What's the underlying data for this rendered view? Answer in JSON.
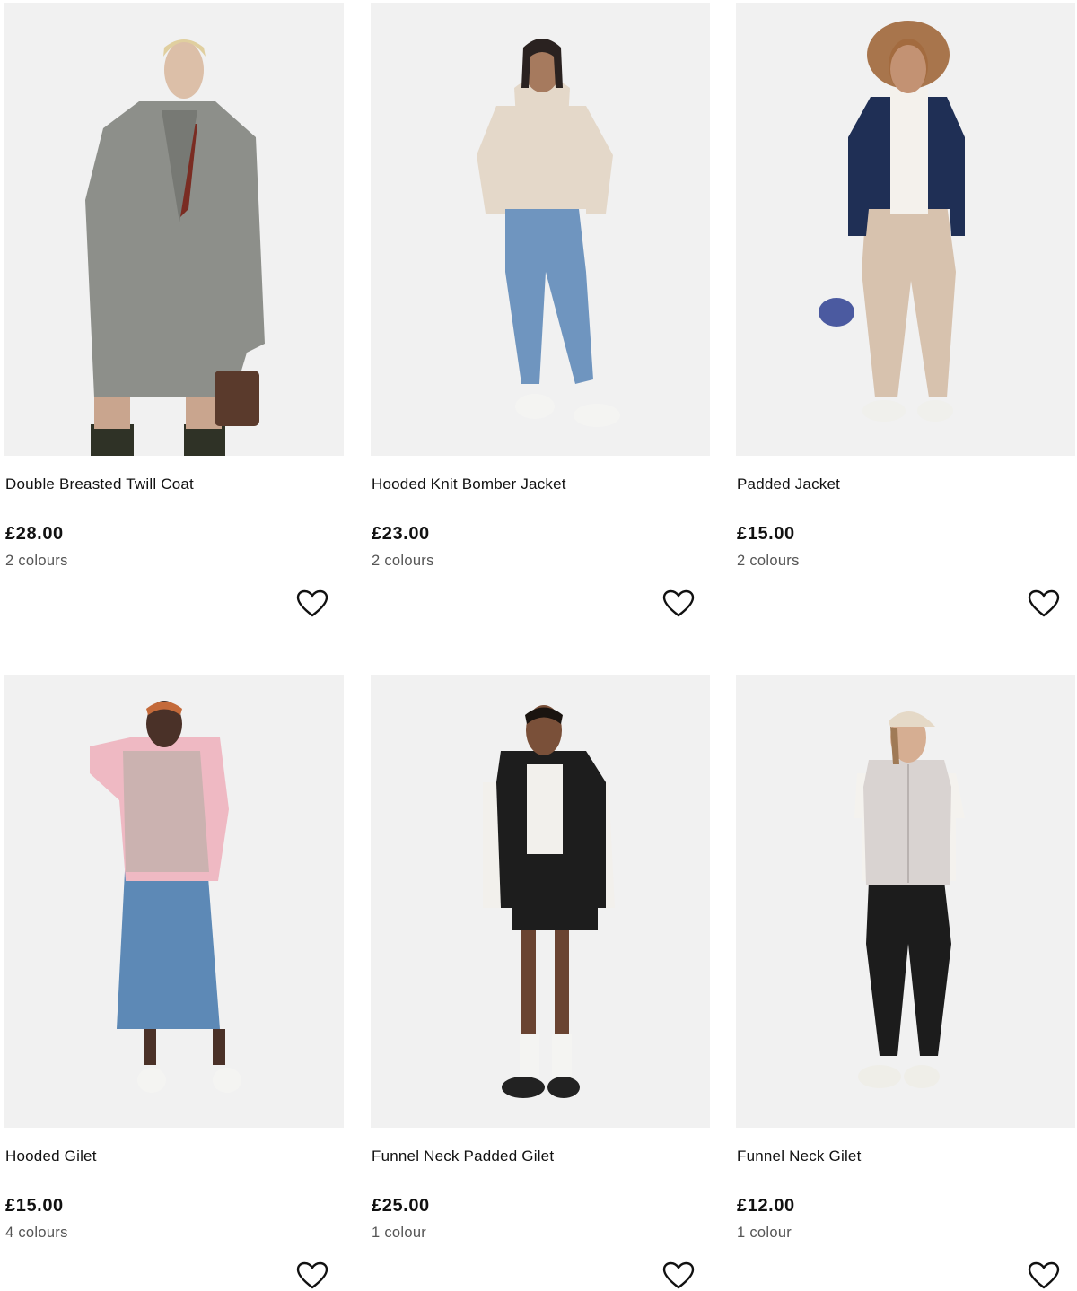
{
  "colors": {
    "text": "#111111",
    "muted": "#555555",
    "photo_bg": "#f1f1f1",
    "background": "#ffffff"
  },
  "products": [
    {
      "name": "Double Breasted Twill Coat",
      "price": "£28.00",
      "colours": "2 colours",
      "wishlist_icon": "heart-outline-icon"
    },
    {
      "name": "Hooded Knit Bomber Jacket",
      "price": "£23.00",
      "colours": "2 colours",
      "wishlist_icon": "heart-outline-icon"
    },
    {
      "name": "Padded Jacket",
      "price": "£15.00",
      "colours": "2 colours",
      "wishlist_icon": "heart-outline-icon"
    },
    {
      "name": "Hooded Gilet",
      "price": "£15.00",
      "colours": "4 colours",
      "wishlist_icon": "heart-outline-icon"
    },
    {
      "name": "Funnel Neck Padded Gilet",
      "price": "£25.00",
      "colours": "1 colour",
      "wishlist_icon": "heart-outline-icon"
    },
    {
      "name": "Funnel Neck Gilet",
      "price": "£12.00",
      "colours": "1 colour",
      "wishlist_icon": "heart-outline-icon"
    }
  ]
}
